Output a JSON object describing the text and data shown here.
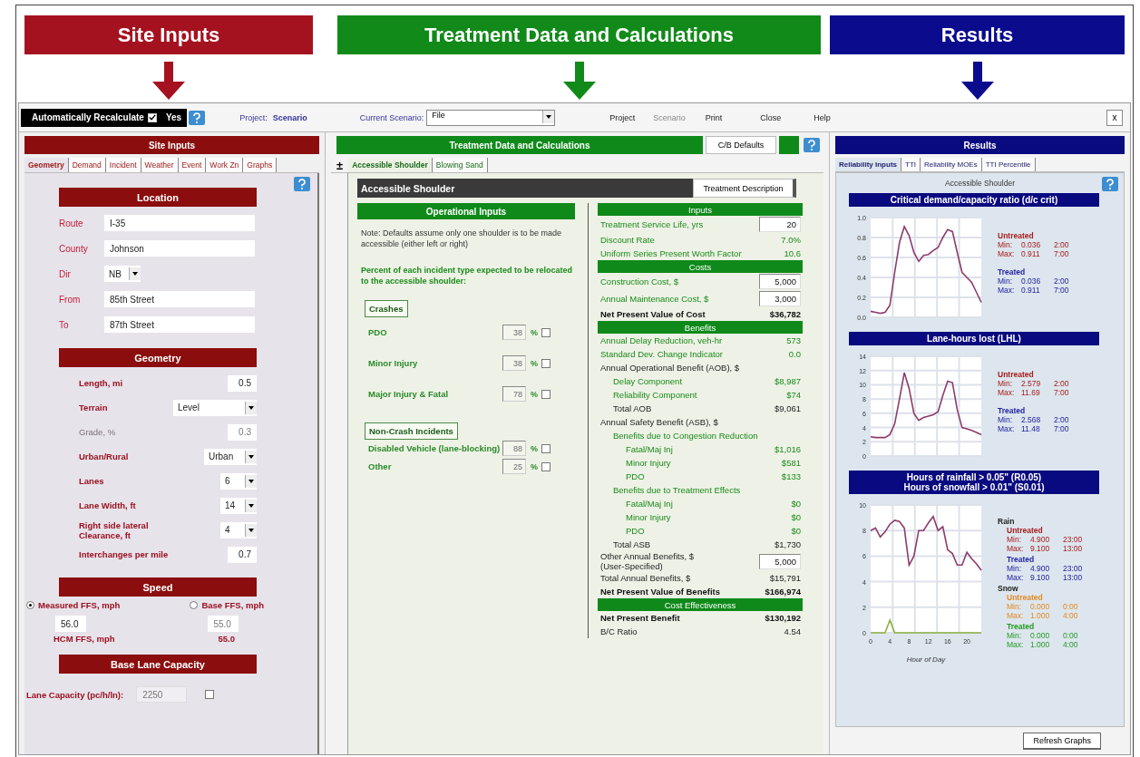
{
  "banners": [
    {
      "title": "Site Inputs",
      "color": "#a5121f"
    },
    {
      "title": "Treatment Data and Calculations",
      "color": "#128a1a"
    },
    {
      "title": "Results",
      "color": "#0b0b8e"
    }
  ],
  "toolbar": {
    "auto_recalc": {
      "label": "Automatically Recalculate",
      "checked": true,
      "value": "Yes"
    },
    "project": {
      "label": "Project:",
      "value": "Scenario"
    },
    "scenario": {
      "label": "Current Scenario:",
      "value": "File"
    },
    "menu": [
      {
        "label": "Project",
        "disabled": false
      },
      {
        "label": "Scenario",
        "disabled": true
      },
      {
        "label": "Print",
        "disabled": false
      },
      {
        "label": "Close",
        "disabled": false
      },
      {
        "label": "Help",
        "disabled": false
      }
    ],
    "close_button": "x"
  },
  "site_inputs": {
    "title": "Site Inputs",
    "tabs": [
      {
        "label": "Geometry",
        "selected": true
      },
      {
        "label": "Demand",
        "selected": false
      },
      {
        "label": "Incident",
        "selected": false
      },
      {
        "label": "Weather",
        "selected": false
      },
      {
        "label": "Event",
        "selected": false
      },
      {
        "label": "Work Zn",
        "selected": false
      },
      {
        "label": "Graphs",
        "selected": false
      }
    ],
    "location": {
      "title": "Location",
      "fields": [
        {
          "label": "Route",
          "value": "I-35",
          "kind": "text"
        },
        {
          "label": "County",
          "value": "Johnson",
          "kind": "text"
        },
        {
          "label": "Dir",
          "value": "NB",
          "kind": "select"
        },
        {
          "label": "From",
          "value": "85th Street",
          "kind": "text"
        },
        {
          "label": "To",
          "value": "87th Street",
          "kind": "text"
        }
      ]
    },
    "geometry": {
      "title": "Geometry",
      "fields": [
        {
          "label": "Length, mi",
          "value": "0.5",
          "kind": "text",
          "disabled": false
        },
        {
          "label": "Terrain",
          "value": "Level",
          "kind": "select",
          "disabled": false
        },
        {
          "label": "Grade, %",
          "value": "0.3",
          "kind": "text",
          "disabled": true
        },
        {
          "label": "Urban/Rural",
          "value": "Urban",
          "kind": "select",
          "disabled": false
        },
        {
          "label": "Lanes",
          "value": "6",
          "kind": "select",
          "disabled": false
        },
        {
          "label": "Lane Width, ft",
          "value": "14",
          "kind": "select",
          "disabled": false
        },
        {
          "label": "Right side lateral Clearance, ft",
          "value": "4",
          "kind": "select",
          "disabled": false
        },
        {
          "label": "Interchanges per mile",
          "value": "0.7",
          "kind": "text",
          "disabled": false
        }
      ]
    },
    "speed": {
      "title": "Speed",
      "options": [
        {
          "label": "Measured FFS, mph",
          "selected": true,
          "value": "56.0"
        },
        {
          "label": "Base FFS, mph",
          "selected": false,
          "value": "55.0"
        }
      ],
      "hcm_label": "HCM FFS, mph",
      "hcm_value": "55.0"
    },
    "capacity": {
      "title": "Base Lane Capacity",
      "label": "Lane Capacity (pc/h/ln):",
      "value": "2250",
      "checked": false
    }
  },
  "treatment": {
    "title": "Treatment Data and Calculations",
    "defaults_button": "C/B Defaults",
    "expander": "±",
    "tabs": [
      {
        "label": "Accessible Shoulder",
        "selected": true
      },
      {
        "label": "Blowing Sand",
        "selected": false
      }
    ],
    "heading": "Accessible Shoulder",
    "description_button": "Treatment Description",
    "operational": {
      "title": "Operational Inputs",
      "note": "Note: Defaults assume only one shoulder is to be made accessible (either left or right)",
      "prompt": "Percent of each incident type expected to be relocated to the accessible shoulder:",
      "groups": [
        {
          "title": "Crashes",
          "items": [
            {
              "label": "PDO",
              "value": "38",
              "unit": "%",
              "checked": false
            },
            {
              "label": "Minor Injury",
              "value": "38",
              "unit": "%",
              "checked": false
            },
            {
              "label": "Major Injury & Fatal",
              "value": "78",
              "unit": "%",
              "checked": false
            }
          ]
        },
        {
          "title": "Non-Crash Incidents",
          "items": [
            {
              "label": "Disabled Vehicle (lane-blocking)",
              "value": "88",
              "unit": "%",
              "checked": false
            },
            {
              "label": "Other",
              "value": "25",
              "unit": "%",
              "checked": false
            }
          ]
        }
      ]
    },
    "calculations": [
      {
        "title": "Inputs",
        "rows": [
          {
            "label": "Treatment Service Life, yrs",
            "value": "20",
            "kind": "input"
          },
          {
            "label": "Discount Rate",
            "value": "7.0%",
            "kind": "calc"
          },
          {
            "label": "Uniform Series Present Worth Factor",
            "value": "10.6",
            "kind": "calc"
          }
        ]
      },
      {
        "title": "Costs",
        "rows": [
          {
            "label": "Construction Cost, $",
            "value": "5,000",
            "kind": "input"
          },
          {
            "label": "Annual Maintenance Cost, $",
            "value": "3,000",
            "kind": "input"
          },
          {
            "label": "Net Present Value of Cost",
            "value": "$36,782",
            "kind": "key"
          }
        ]
      },
      {
        "title": "Benefits",
        "rows": [
          {
            "label": "Annual Delay Reduction, veh-hr",
            "value": "573",
            "kind": "calc"
          },
          {
            "label": "Standard Dev. Change Indicator",
            "value": "0.0",
            "kind": "calc"
          },
          {
            "label": "Annual Operational Benefit (AOB), $",
            "kind": "group",
            "children": [
              {
                "label": "Delay Component",
                "value": "$8,987",
                "kind": "calc"
              },
              {
                "label": "Reliability Component",
                "value": "$74",
                "kind": "calc"
              },
              {
                "label": "Total AOB",
                "value": "$9,061",
                "kind": "total"
              }
            ]
          },
          {
            "label": "Annual Safety Benefit (ASB), $",
            "kind": "group",
            "children": [
              {
                "label": "Benefits due to Congestion Reduction",
                "kind": "calc",
                "children": [
                  {
                    "label": "Fatal/Maj Inj",
                    "value": "$1,016",
                    "kind": "calc"
                  },
                  {
                    "label": "Minor Injury",
                    "value": "$581",
                    "kind": "calc"
                  },
                  {
                    "label": "PDO",
                    "value": "$133",
                    "kind": "calc"
                  }
                ]
              },
              {
                "label": "Benefits due to Treatment Effects",
                "kind": "calc",
                "children": [
                  {
                    "label": "Fatal/Maj Inj",
                    "value": "$0",
                    "kind": "calc"
                  },
                  {
                    "label": "Minor Injury",
                    "value": "$0",
                    "kind": "calc"
                  },
                  {
                    "label": "PDO",
                    "value": "$0",
                    "kind": "calc"
                  }
                ]
              },
              {
                "label": "Total ASB",
                "value": "$1,730",
                "kind": "total"
              }
            ]
          },
          {
            "label": "Other Annual Benefits, $ (User-Specified)",
            "value": "5,000",
            "kind": "entry"
          },
          {
            "label": "Total Annual Benefits, $",
            "value": "$15,791",
            "kind": "total"
          },
          {
            "label": "Net Present Value of Benefits",
            "value": "$166,974",
            "kind": "key"
          }
        ]
      },
      {
        "title": "Cost Effectiveness",
        "rows": [
          {
            "label": "Net Present Benefit",
            "value": "$130,192",
            "kind": "key"
          },
          {
            "label": "B/C Ratio",
            "value": "4.54",
            "kind": "total"
          }
        ]
      }
    ]
  },
  "results": {
    "title": "Results",
    "tabs": [
      {
        "label": "Reliability Inputs",
        "selected": true
      },
      {
        "label": "TTI",
        "selected": false
      },
      {
        "label": "Reliability MOEs",
        "selected": false
      },
      {
        "label": "TTI Percentile",
        "selected": false
      }
    ],
    "subtitle": "Accessible Shoulder",
    "panels": [
      {
        "title_lines": [
          "Critical demand/capacity ratio (d/c crit)"
        ],
        "chart_data": {
          "type": "line",
          "x": [
            0,
            1,
            2,
            3,
            4,
            5,
            6,
            7,
            8,
            9,
            10,
            11,
            12,
            13,
            14,
            15,
            16,
            17,
            18,
            19,
            20,
            21,
            22,
            23
          ],
          "xlim": [
            0,
            23
          ],
          "ylim": [
            0,
            1
          ],
          "yticks": [
            {
              "value": 0,
              "label": "0.0"
            },
            {
              "value": 0.2,
              "label": "0.2"
            },
            {
              "value": 0.4,
              "label": "0.4"
            },
            {
              "value": 0.6,
              "label": "0.6"
            },
            {
              "value": 0.8,
              "label": "0.8"
            },
            {
              "value": 1,
              "label": "1.0"
            }
          ],
          "grid": true,
          "series": [
            {
              "color": "#8c3c6c",
              "values": [
                0.06,
                0.05,
                0.04,
                0.05,
                0.12,
                0.45,
                0.75,
                0.91,
                0.82,
                0.65,
                0.56,
                0.62,
                0.63,
                0.67,
                0.7,
                0.8,
                0.88,
                0.86,
                0.65,
                0.45,
                0.4,
                0.35,
                0.25,
                0.15
              ]
            }
          ]
        },
        "legend": [
          {
            "groups": [
              {
                "title": "Untreated",
                "color": "#a81c1c",
                "rows": [
                  {
                    "label": "Min:",
                    "value": "0.036",
                    "time": "2:00"
                  },
                  {
                    "label": "Max:",
                    "value": "0.911",
                    "time": "7:00"
                  }
                ]
              },
              {
                "title": "Treated",
                "color": "#2323a0",
                "rows": [
                  {
                    "label": "Min:",
                    "value": "0.036",
                    "time": "2:00"
                  },
                  {
                    "label": "Max:",
                    "value": "0.911",
                    "time": "7:00"
                  }
                ]
              }
            ]
          }
        ]
      },
      {
        "title_lines": [
          "Lane-hours lost (LHL)"
        ],
        "chart_data": {
          "type": "line",
          "x": [
            0,
            1,
            2,
            3,
            4,
            5,
            6,
            7,
            8,
            9,
            10,
            11,
            12,
            13,
            14,
            15,
            16,
            17,
            18,
            19,
            20,
            21,
            22,
            23
          ],
          "xlim": [
            0,
            23
          ],
          "ylim": [
            0,
            14
          ],
          "yticks": [
            0,
            2,
            4,
            6,
            8,
            10,
            12,
            14
          ],
          "grid": true,
          "series": [
            {
              "color": "#8c3c6c",
              "values": [
                2.7,
                2.6,
                2.6,
                2.6,
                3.0,
                4.5,
                8.0,
                11.7,
                9.5,
                6.0,
                5.0,
                5.4,
                5.6,
                5.8,
                6.2,
                8.5,
                10.5,
                10.3,
                6.5,
                4.0,
                3.8,
                3.6,
                3.3,
                3.0
              ]
            }
          ]
        },
        "legend": [
          {
            "groups": [
              {
                "title": "Untreated",
                "color": "#a81c1c",
                "rows": [
                  {
                    "label": "Min:",
                    "value": "2.579",
                    "time": "2:00"
                  },
                  {
                    "label": "Max:",
                    "value": "11.69",
                    "time": "7:00"
                  }
                ]
              },
              {
                "title": "Treated",
                "color": "#2323a0",
                "rows": [
                  {
                    "label": "Min:",
                    "value": "2.568",
                    "time": "2:00"
                  },
                  {
                    "label": "Max:",
                    "value": "11.48",
                    "time": "7:00"
                  }
                ]
              }
            ]
          }
        ]
      },
      {
        "title_lines": [
          "Hours of rainfall > 0.05\" (R0.05)",
          "Hours of snowfall > 0.01\" (S0.01)"
        ],
        "chart_data": {
          "type": "line",
          "x": [
            0,
            1,
            2,
            3,
            4,
            5,
            6,
            7,
            8,
            9,
            10,
            11,
            12,
            13,
            14,
            15,
            16,
            17,
            18,
            19,
            20,
            21,
            22,
            23
          ],
          "xlim": [
            0,
            23
          ],
          "ylim": [
            0,
            10
          ],
          "xlabel": "Hour of Day",
          "xticks": [
            0,
            4,
            8,
            12,
            16,
            20
          ],
          "yticks": [
            0,
            2,
            4,
            6,
            8,
            10
          ],
          "grid": true,
          "series": [
            {
              "color": "#8c3c6c",
              "values": [
                8.0,
                8.2,
                7.5,
                7.9,
                8.5,
                8.8,
                8.7,
                8.2,
                5.3,
                6.0,
                8.0,
                8.0,
                8.6,
                9.1,
                8.0,
                8.3,
                6.5,
                6.2,
                5.3,
                5.3,
                6.3,
                5.8,
                5.4,
                4.9
              ]
            },
            {
              "color": "#8ab040",
              "values": [
                0,
                0,
                0,
                0,
                1,
                0,
                0,
                0,
                0,
                0,
                0,
                0,
                0,
                0,
                0,
                0,
                0,
                0,
                0,
                0,
                0,
                0,
                0,
                0
              ]
            }
          ]
        },
        "legend": [
          {
            "heading": "Rain",
            "groups": [
              {
                "title": "Untreated",
                "color": "#a81c1c",
                "rows": [
                  {
                    "label": "Min:",
                    "value": "4.900",
                    "time": "23:00"
                  },
                  {
                    "label": "Max:",
                    "value": "9.100",
                    "time": "13:00"
                  }
                ]
              },
              {
                "title": "Treated",
                "color": "#2323a0",
                "rows": [
                  {
                    "label": "Min:",
                    "value": "4.900",
                    "time": "23:00"
                  },
                  {
                    "label": "Max:",
                    "value": "9.100",
                    "time": "13:00"
                  }
                ]
              }
            ]
          },
          {
            "heading": "Snow",
            "groups": [
              {
                "title": "Untreated",
                "color": "#e38a22",
                "rows": [
                  {
                    "label": "Min:",
                    "value": "0.000",
                    "time": "0:00"
                  },
                  {
                    "label": "Max:",
                    "value": "1.000",
                    "time": "4:00"
                  }
                ]
              },
              {
                "title": "Treated",
                "color": "#249a24",
                "rows": [
                  {
                    "label": "Min:",
                    "value": "0.000",
                    "time": "0:00"
                  },
                  {
                    "label": "Max:",
                    "value": "1.000",
                    "time": "4:00"
                  }
                ]
              }
            ]
          }
        ]
      }
    ],
    "refresh_button": "Refresh Graphs"
  }
}
